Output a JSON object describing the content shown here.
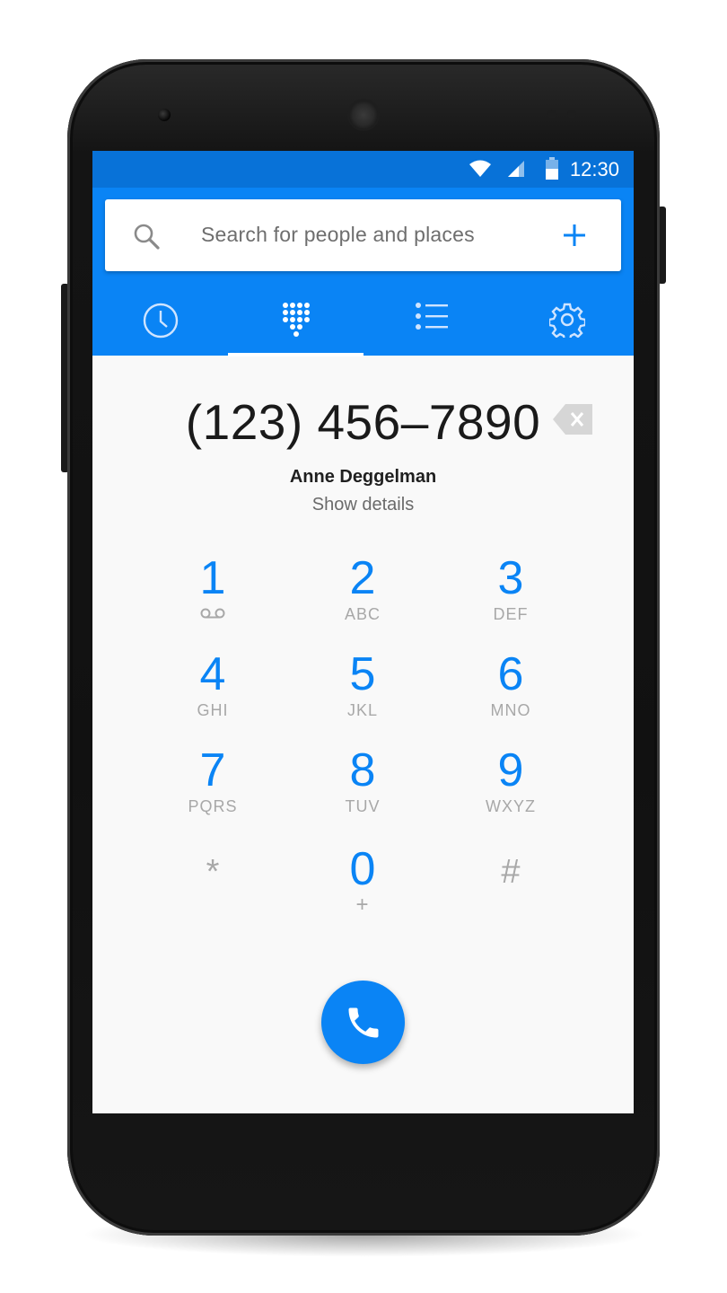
{
  "status_bar": {
    "time": "12:30",
    "icons": [
      "wifi-icon",
      "signal-icon",
      "battery-icon"
    ]
  },
  "search": {
    "placeholder": "Search for people and places",
    "icon": "search-icon",
    "add_icon": "add-icon"
  },
  "tabs": [
    {
      "name": "recents",
      "icon": "clock-icon",
      "selected": false
    },
    {
      "name": "dialpad",
      "icon": "dialpad-icon",
      "selected": true
    },
    {
      "name": "contacts",
      "icon": "list-icon",
      "selected": false
    },
    {
      "name": "settings",
      "icon": "gear-icon",
      "selected": false
    }
  ],
  "dialer": {
    "number": "(123) 456–7890",
    "contact_name": "Anne Deggelman",
    "details_link": "Show details"
  },
  "keypad": [
    {
      "digit": "1",
      "letters": ""
    },
    {
      "digit": "2",
      "letters": "ABC"
    },
    {
      "digit": "3",
      "letters": "DEF"
    },
    {
      "digit": "4",
      "letters": "GHI"
    },
    {
      "digit": "5",
      "letters": "JKL"
    },
    {
      "digit": "6",
      "letters": "MNO"
    },
    {
      "digit": "7",
      "letters": "PQRS"
    },
    {
      "digit": "8",
      "letters": "TUV"
    },
    {
      "digit": "9",
      "letters": "WXYZ"
    },
    {
      "digit": "*",
      "letters": ""
    },
    {
      "digit": "0",
      "letters": "+"
    },
    {
      "digit": "#",
      "letters": ""
    }
  ],
  "colors": {
    "status_bar": "#0872d8",
    "app_bar": "#0a84f5",
    "accent": "#0a84f5",
    "secondary_text": "#a8a8a8"
  }
}
